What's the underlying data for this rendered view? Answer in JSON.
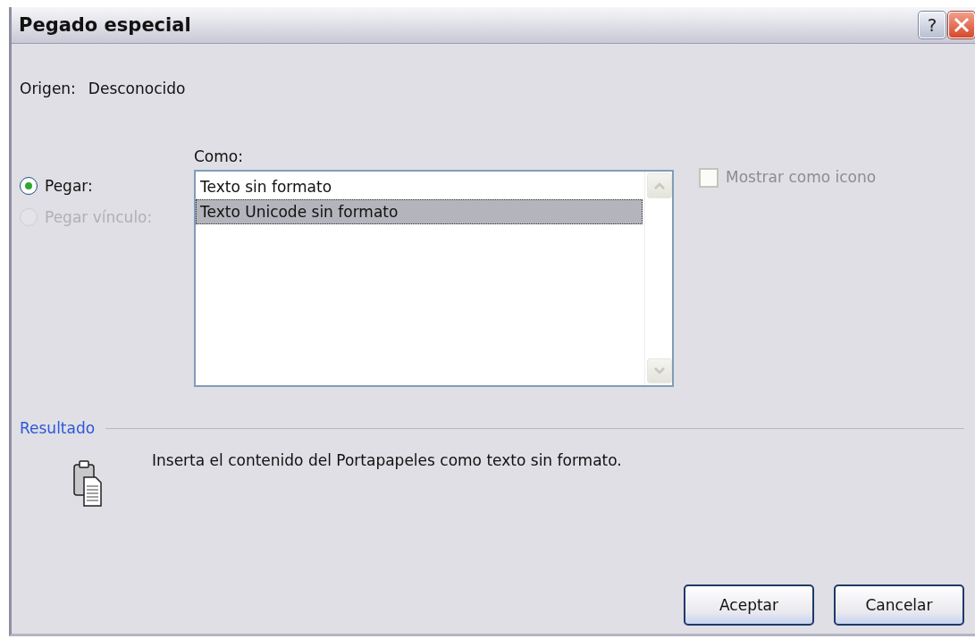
{
  "window": {
    "title": "Pegado especial",
    "help_button": "?"
  },
  "source": {
    "label": "Origen:",
    "value": "Desconocido"
  },
  "paste_options": [
    {
      "label": "Pegar:",
      "selected": true,
      "disabled": false
    },
    {
      "label": "Pegar vínculo:",
      "selected": false,
      "disabled": true
    }
  ],
  "as_list": {
    "label": "Como:",
    "items": [
      {
        "label": "Texto sin formato",
        "selected": false
      },
      {
        "label": "Texto Unicode sin formato",
        "selected": true
      }
    ]
  },
  "display_as_icon": {
    "label": "Mostrar como icono",
    "checked": false,
    "disabled": true
  },
  "result": {
    "title": "Resultado",
    "description": "Inserta el contenido del Portapapeles como texto sin formato."
  },
  "buttons": [
    "Aceptar",
    "Cancelar"
  ]
}
